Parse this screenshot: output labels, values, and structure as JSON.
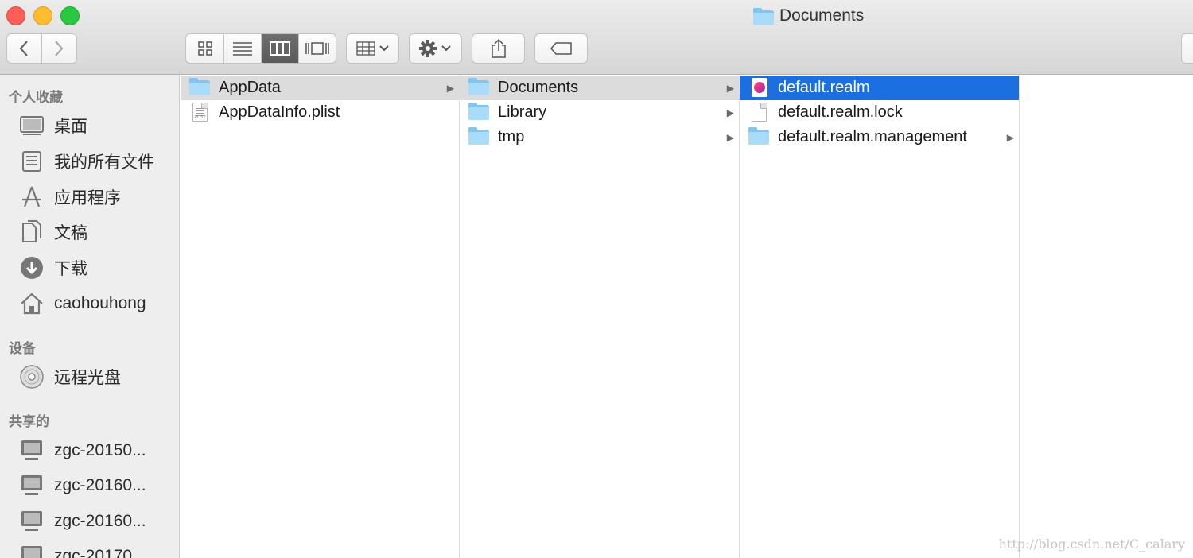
{
  "window": {
    "title": "Documents"
  },
  "toolbar": {
    "back_icon": "chevron-left-icon",
    "forward_icon": "chevron-right-icon",
    "views": [
      "icon-view",
      "list-view",
      "column-view",
      "cover-flow-view"
    ],
    "active_view": "column-view"
  },
  "sidebar": {
    "favorites_header": "个人收藏",
    "favorites": [
      {
        "label": "桌面",
        "icon": "desktop-icon"
      },
      {
        "label": "我的所有文件",
        "icon": "all-files-icon"
      },
      {
        "label": "应用程序",
        "icon": "applications-icon"
      },
      {
        "label": "文稿",
        "icon": "documents-icon"
      },
      {
        "label": "下载",
        "icon": "downloads-icon"
      },
      {
        "label": "caohouhong",
        "icon": "home-icon"
      }
    ],
    "devices_header": "设备",
    "devices": [
      {
        "label": "远程光盘",
        "icon": "disc-icon"
      }
    ],
    "shared_header": "共享的",
    "shared": [
      {
        "label": "zgc-20150...",
        "icon": "computer-icon"
      },
      {
        "label": "zgc-20160...",
        "icon": "computer-icon"
      },
      {
        "label": "zgc-20160...",
        "icon": "computer-icon"
      },
      {
        "label": "zgc-20170...",
        "icon": "computer-icon"
      }
    ]
  },
  "columns": [
    {
      "items": [
        {
          "label": "AppData",
          "type": "folder",
          "has_children": true,
          "state": "path"
        },
        {
          "label": "AppDataInfo.plist",
          "type": "plist",
          "has_children": false,
          "state": "none"
        }
      ]
    },
    {
      "items": [
        {
          "label": "Documents",
          "type": "folder",
          "has_children": true,
          "state": "path"
        },
        {
          "label": "Library",
          "type": "folder",
          "has_children": true,
          "state": "none"
        },
        {
          "label": "tmp",
          "type": "folder",
          "has_children": true,
          "state": "none"
        }
      ]
    },
    {
      "items": [
        {
          "label": "default.realm",
          "type": "realm",
          "has_children": false,
          "state": "selected"
        },
        {
          "label": "default.realm.lock",
          "type": "file",
          "has_children": false,
          "state": "none"
        },
        {
          "label": "default.realm.management",
          "type": "folder",
          "has_children": true,
          "state": "none"
        }
      ]
    }
  ],
  "watermark": "http://blog.csdn.net/C_calary"
}
